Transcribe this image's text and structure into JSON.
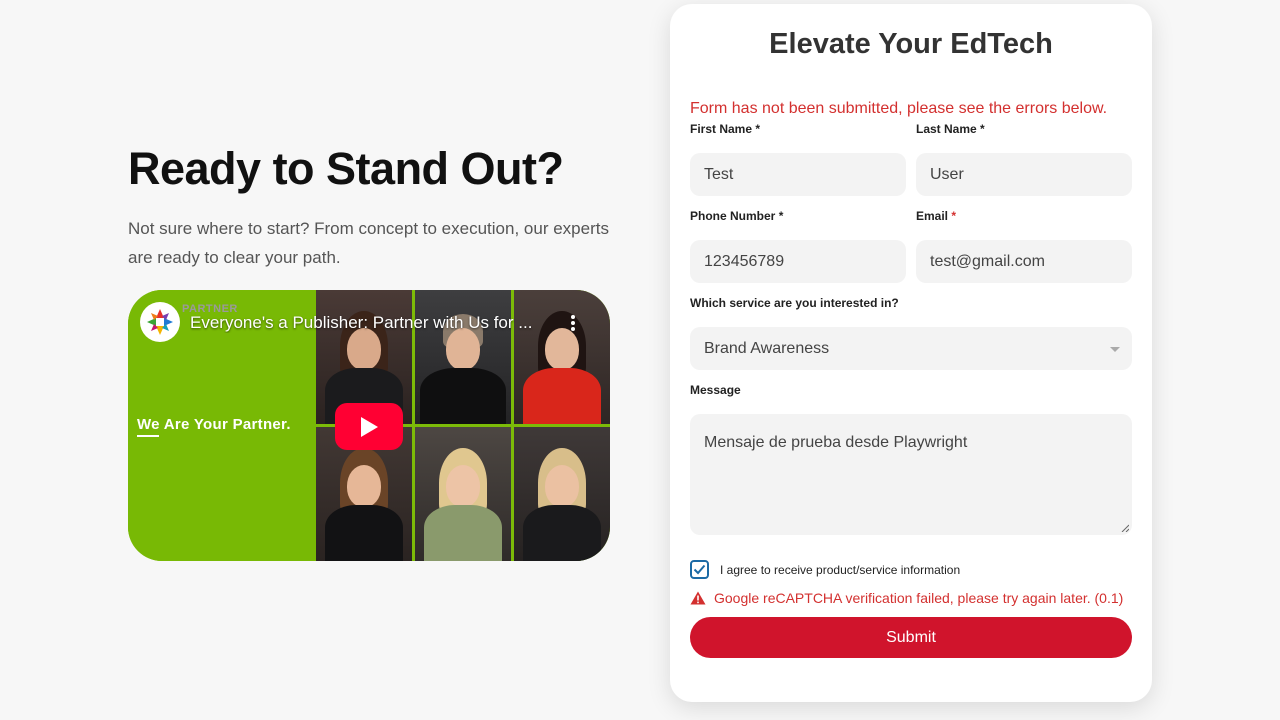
{
  "hero": {
    "headline": "Ready to Stand Out?",
    "subtext": "Not sure where to start? From concept to execution, our experts are ready to clear your path."
  },
  "video": {
    "title": "Everyone's a Publisher: Partner with Us for ...",
    "channel_logo_text": "PARTNER",
    "tagline": "We Are Your Partner.",
    "brand_color": "#78b905",
    "play_color": "#ff0033",
    "icons": [
      "partner-logo-icon",
      "kebab-menu-icon",
      "play-icon"
    ]
  },
  "form": {
    "title": "Elevate Your EdTech",
    "error_message": "Form has not been submitted, please see the errors below.",
    "fields": {
      "first_name": {
        "label": "First Name",
        "required_mark": "*",
        "value": "Test"
      },
      "last_name": {
        "label": "Last Name",
        "required_mark": "*",
        "value": "User"
      },
      "phone": {
        "label": "Phone Number",
        "required_mark": "*",
        "value": "123456789"
      },
      "email": {
        "label": "Email",
        "required_mark": "*",
        "value": "test@gmail.com"
      },
      "service": {
        "label": "Which service are you interested in?",
        "value": "Brand Awareness"
      },
      "message": {
        "label": "Message",
        "value": "Mensaje de prueba desde Playwright"
      }
    },
    "consent_label": "I agree to receive product/service information",
    "consent_checked": true,
    "captcha_error": "Google reCAPTCHA verification failed, please try again later. (0.1)",
    "submit_label": "Submit",
    "accent_color": "#d0142c",
    "error_color": "#d3302f"
  }
}
